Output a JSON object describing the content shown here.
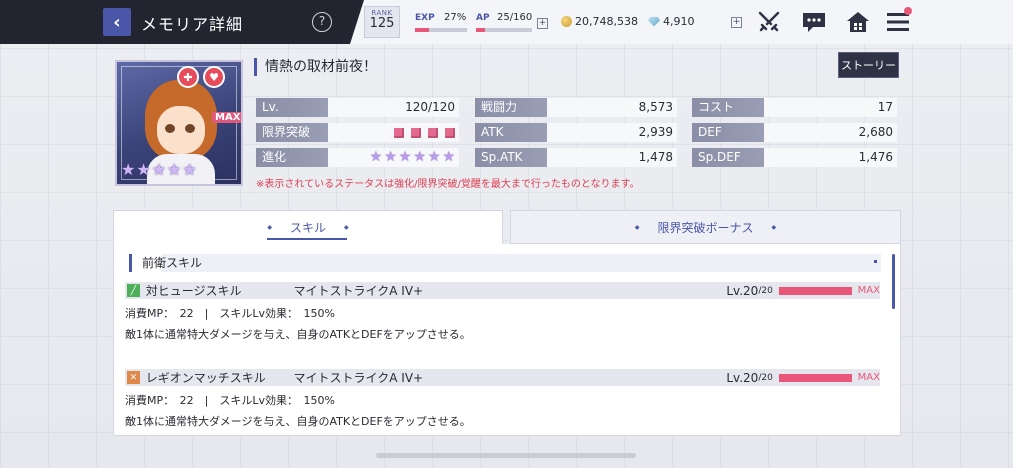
{
  "header": {
    "title": "メモリア詳細",
    "help_label": "?",
    "rank_label": "RANK",
    "rank_value": "125",
    "exp_label": "EXP",
    "exp_value": "27%",
    "exp_progress": 0.27,
    "ap_label": "AP",
    "ap_value": "25/160",
    "ap_progress": 0.156,
    "coins": "20,748,538",
    "gems": "4,910",
    "plus_label": "+"
  },
  "memoria": {
    "name": "情熱の取材前夜！",
    "max_badge": "MAX",
    "story_button": "ストーリー",
    "portrait_stars": 5,
    "stats": {
      "lv_label": "Lv.",
      "lv_value": "120/120",
      "limit_label": "限界突破",
      "limit_count": 4,
      "evo_label": "進化",
      "evo_count": 6,
      "power_label": "戦闘力",
      "power_value": "8,573",
      "atk_label": "ATK",
      "atk_value": "2,939",
      "spatk_label": "Sp.ATK",
      "spatk_value": "1,478",
      "cost_label": "コスト",
      "cost_value": "17",
      "def_label": "DEF",
      "def_value": "2,680",
      "spdef_label": "Sp.DEF",
      "spdef_value": "1,476"
    },
    "note": "※表示されているステータスは強化/限界突破/覚醒を最大まで行ったものとなります。"
  },
  "tabs": {
    "skill": "スキル",
    "limit_bonus": "限界突破ボーナス"
  },
  "skills": {
    "section_title": "前衛スキル",
    "items": [
      {
        "type": "対ヒュージスキル",
        "name": "マイトストライクA IV+",
        "lv": "Lv.20",
        "lv_max": "/20",
        "lv_progress": 1.0,
        "max_label": "MAX",
        "mp_text": "消費MP：　22　|　スキルLv効果：　150%",
        "desc": "敵1体に通常特大ダメージを与え、自身のATKとDEFをアップさせる。",
        "icon_color": "#4fae5a"
      },
      {
        "type": "レギオンマッチスキル",
        "name": "マイトストライクA IV+",
        "lv": "Lv.20",
        "lv_max": "/20",
        "lv_progress": 1.0,
        "max_label": "MAX",
        "mp_text": "消費MP：　22　|　スキルLv効果：　150%",
        "desc": "敵1体に通常特大ダメージを与え、自身のATKとDEFをアップさせる。",
        "icon_color": "#e0874a"
      }
    ]
  }
}
